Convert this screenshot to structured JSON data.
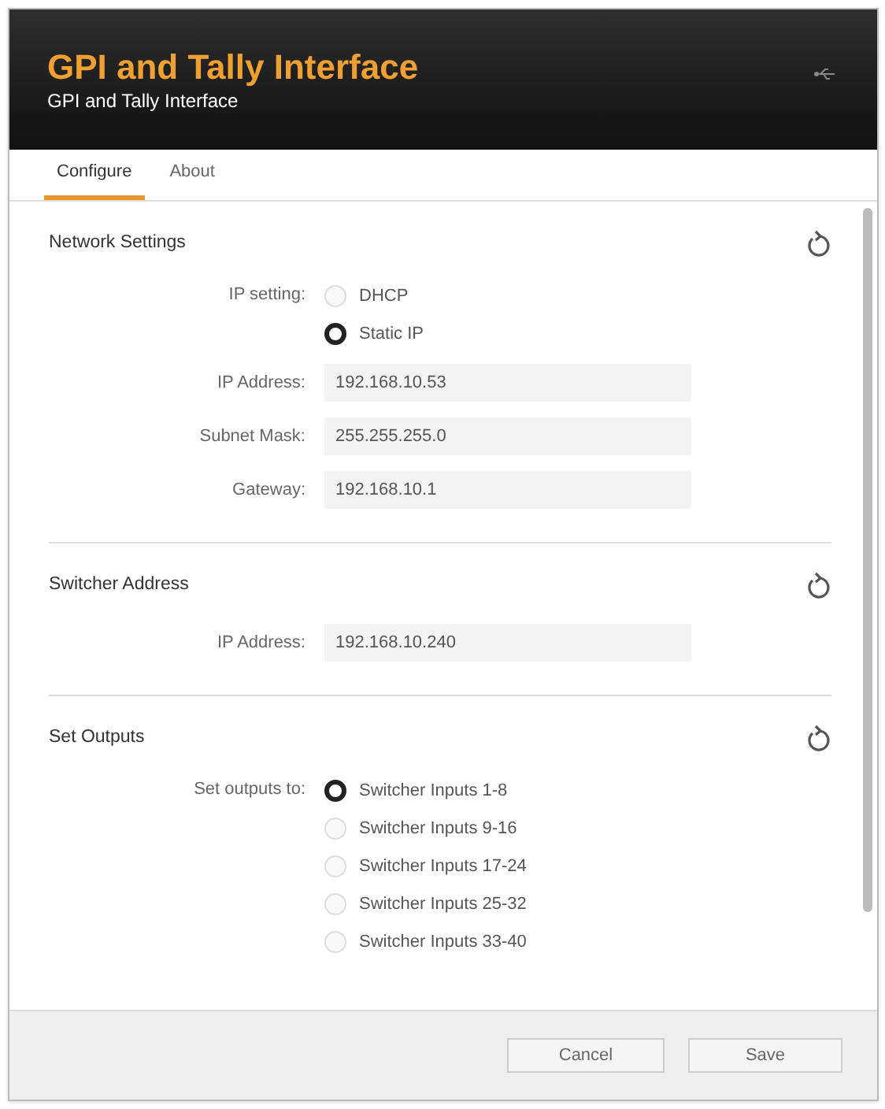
{
  "window": {
    "title": "GPI and Tally Interface",
    "subtitle": "GPI and Tally Interface"
  },
  "tabs": [
    {
      "label": "Configure",
      "selected": true
    },
    {
      "label": "About",
      "selected": false
    }
  ],
  "sections": [
    {
      "title": "Network Settings",
      "rows": [
        {
          "kind": "radio_group",
          "label": "IP setting:",
          "options": [
            {
              "label": "DHCP",
              "selected": false
            },
            {
              "label": "Static IP",
              "selected": true
            }
          ]
        },
        {
          "kind": "field",
          "label": "IP Address:",
          "value": "192.168.10.53"
        },
        {
          "kind": "field",
          "label": "Subnet Mask:",
          "value": "255.255.255.0"
        },
        {
          "kind": "field",
          "label": "Gateway:",
          "value": "192.168.10.1"
        }
      ]
    },
    {
      "title": "Switcher Address",
      "rows": [
        {
          "kind": "field",
          "label": "IP Address:",
          "value": "192.168.10.240"
        }
      ]
    },
    {
      "title": "Set Outputs",
      "rows": [
        {
          "kind": "radio_group",
          "label": "Set outputs to:",
          "options": [
            {
              "label": "Switcher Inputs 1-8",
              "selected": true
            },
            {
              "label": "Switcher Inputs 9-16",
              "selected": false
            },
            {
              "label": "Switcher Inputs 17-24",
              "selected": false
            },
            {
              "label": "Switcher Inputs 25-32",
              "selected": false
            },
            {
              "label": "Switcher Inputs 33-40",
              "selected": false
            }
          ]
        }
      ]
    }
  ],
  "buttons": [
    "Cancel",
    "Save"
  ]
}
